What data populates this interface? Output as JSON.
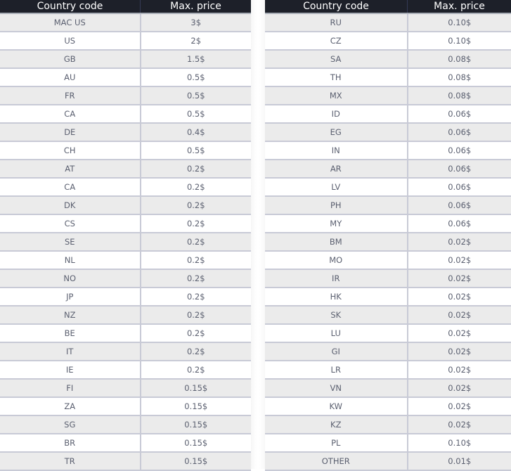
{
  "headers": {
    "country_code": "Country code",
    "max_price": "Max. price"
  },
  "tables": [
    {
      "rows": [
        {
          "code": "MAC US",
          "price": "3$"
        },
        {
          "code": "US",
          "price": "2$"
        },
        {
          "code": "GB",
          "price": "1.5$"
        },
        {
          "code": "AU",
          "price": "0.5$"
        },
        {
          "code": "FR",
          "price": "0.5$"
        },
        {
          "code": "CA",
          "price": "0.5$"
        },
        {
          "code": "DE",
          "price": "0.4$"
        },
        {
          "code": "CH",
          "price": "0.5$"
        },
        {
          "code": "AT",
          "price": "0.2$"
        },
        {
          "code": "CA",
          "price": "0.2$"
        },
        {
          "code": "DK",
          "price": "0.2$"
        },
        {
          "code": "CS",
          "price": "0.2$"
        },
        {
          "code": "SE",
          "price": "0.2$"
        },
        {
          "code": "NL",
          "price": "0.2$"
        },
        {
          "code": "NO",
          "price": "0.2$"
        },
        {
          "code": "JP",
          "price": "0.2$"
        },
        {
          "code": "NZ",
          "price": "0.2$"
        },
        {
          "code": "BE",
          "price": "0.2$"
        },
        {
          "code": "IT",
          "price": "0.2$"
        },
        {
          "code": "IE",
          "price": "0.2$"
        },
        {
          "code": "FI",
          "price": "0.15$"
        },
        {
          "code": "ZA",
          "price": "0.15$"
        },
        {
          "code": "SG",
          "price": "0.15$"
        },
        {
          "code": "BR",
          "price": "0.15$"
        },
        {
          "code": "TR",
          "price": "0.15$"
        }
      ]
    },
    {
      "rows": [
        {
          "code": "RU",
          "price": "0.10$"
        },
        {
          "code": "CZ",
          "price": "0.10$"
        },
        {
          "code": "SA",
          "price": "0.08$"
        },
        {
          "code": "TH",
          "price": "0.08$"
        },
        {
          "code": "MX",
          "price": "0.08$"
        },
        {
          "code": "ID",
          "price": "0.06$"
        },
        {
          "code": "EG",
          "price": "0.06$"
        },
        {
          "code": "IN",
          "price": "0.06$"
        },
        {
          "code": "AR",
          "price": "0.06$"
        },
        {
          "code": "LV",
          "price": "0.06$"
        },
        {
          "code": "PH",
          "price": "0.06$"
        },
        {
          "code": "MY",
          "price": "0.06$"
        },
        {
          "code": "BM",
          "price": "0.02$"
        },
        {
          "code": "MO",
          "price": "0.02$"
        },
        {
          "code": "IR",
          "price": "0.02$"
        },
        {
          "code": "HK",
          "price": "0.02$"
        },
        {
          "code": "SK",
          "price": "0.02$"
        },
        {
          "code": "LU",
          "price": "0.02$"
        },
        {
          "code": "GI",
          "price": "0.02$"
        },
        {
          "code": "LR",
          "price": "0.02$"
        },
        {
          "code": "VN",
          "price": "0.02$"
        },
        {
          "code": "KW",
          "price": "0.02$"
        },
        {
          "code": "KZ",
          "price": "0.02$"
        },
        {
          "code": "PL",
          "price": "0.10$"
        },
        {
          "code": "OTHER",
          "price": "0.01$"
        }
      ]
    }
  ]
}
